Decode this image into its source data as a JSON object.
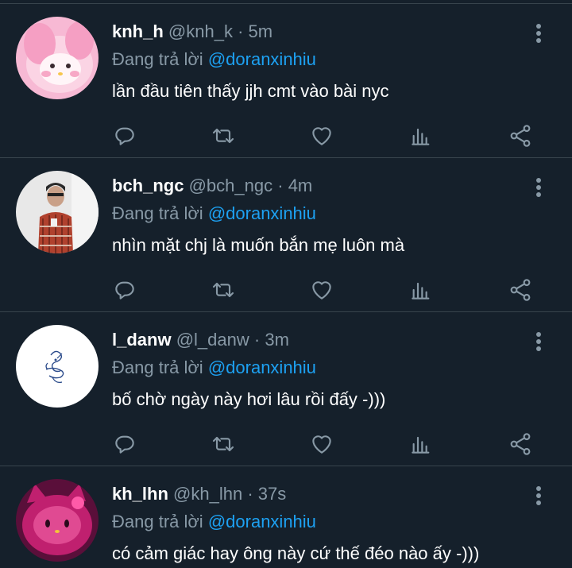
{
  "reply_prefix": "Đang trả lời",
  "tweets": [
    {
      "name": "knh_h",
      "handle": "@knh_k",
      "separator": "·",
      "time": "5m",
      "reply_to": "@doranxinhiu",
      "text": "lần đầu tiên thấy jjh cmt vào bài nyc",
      "avatar": "pink-melody-avatar"
    },
    {
      "name": "bch_ngc",
      "handle": "@bch_ngc",
      "separator": "·",
      "time": "4m",
      "reply_to": "@doranxinhiu",
      "text": "nhìn mặt chj là muốn bắn mẹ luôn mà",
      "avatar": "photo-person-avatar"
    },
    {
      "name": "l_danw",
      "handle": "@l_danw",
      "separator": "·",
      "time": "3m",
      "reply_to": "@doranxinhiu",
      "text": "bố chờ ngày này hơi lâu rồi đấy -)))",
      "avatar": "sketch-avatar"
    },
    {
      "name": "kh_lhn",
      "handle": "@kh_lhn",
      "separator": "·",
      "time": "37s",
      "reply_to": "@doranxinhiu",
      "text": "có cảm giác hay ông này cứ thế đéo nào ấy -)))",
      "avatar": "pink-kitty-avatar"
    }
  ],
  "colors": {
    "background": "#15202b",
    "divider": "#38444d",
    "secondary_text": "#8899a6",
    "mention": "#1da1f2",
    "icon": "#8899a6"
  },
  "icons": [
    "reply-icon",
    "retweet-icon",
    "like-icon",
    "analytics-icon",
    "share-icon",
    "more-icon"
  ]
}
